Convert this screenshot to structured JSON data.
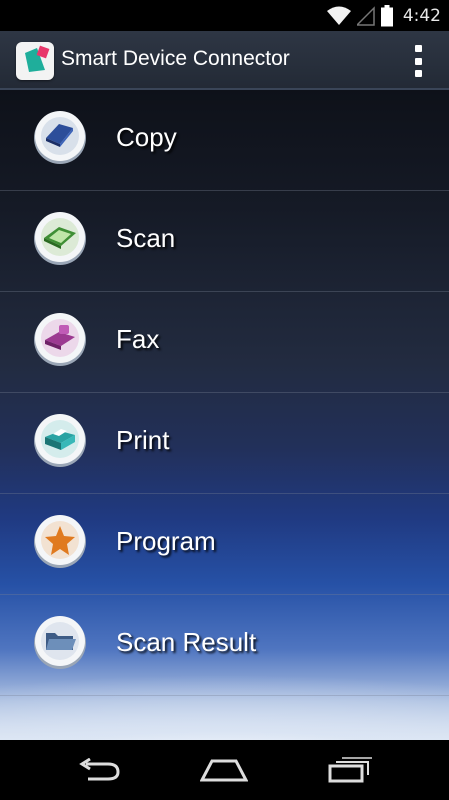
{
  "status_bar": {
    "time": "4:42",
    "icons": [
      "wifi-icon",
      "signal-icon",
      "battery-icon"
    ]
  },
  "action_bar": {
    "title": "Smart Device Connector",
    "app_icon": "app-logo-icon",
    "overflow_icon": "overflow-menu-icon"
  },
  "menu": {
    "items": [
      {
        "label": "Copy",
        "icon": "copy-icon",
        "color": "#3a5ea8"
      },
      {
        "label": "Scan",
        "icon": "scan-icon",
        "color": "#4a9a3a"
      },
      {
        "label": "Fax",
        "icon": "fax-icon",
        "color": "#a03f95"
      },
      {
        "label": "Print",
        "icon": "print-icon",
        "color": "#1f9a9a"
      },
      {
        "label": "Program",
        "icon": "star-icon",
        "color": "#e07a1f"
      },
      {
        "label": "Scan Result",
        "icon": "folder-icon",
        "color": "#5a7aa0"
      }
    ]
  },
  "nav_bar": {
    "icons": [
      "back-icon",
      "home-icon",
      "recent-apps-icon"
    ]
  }
}
